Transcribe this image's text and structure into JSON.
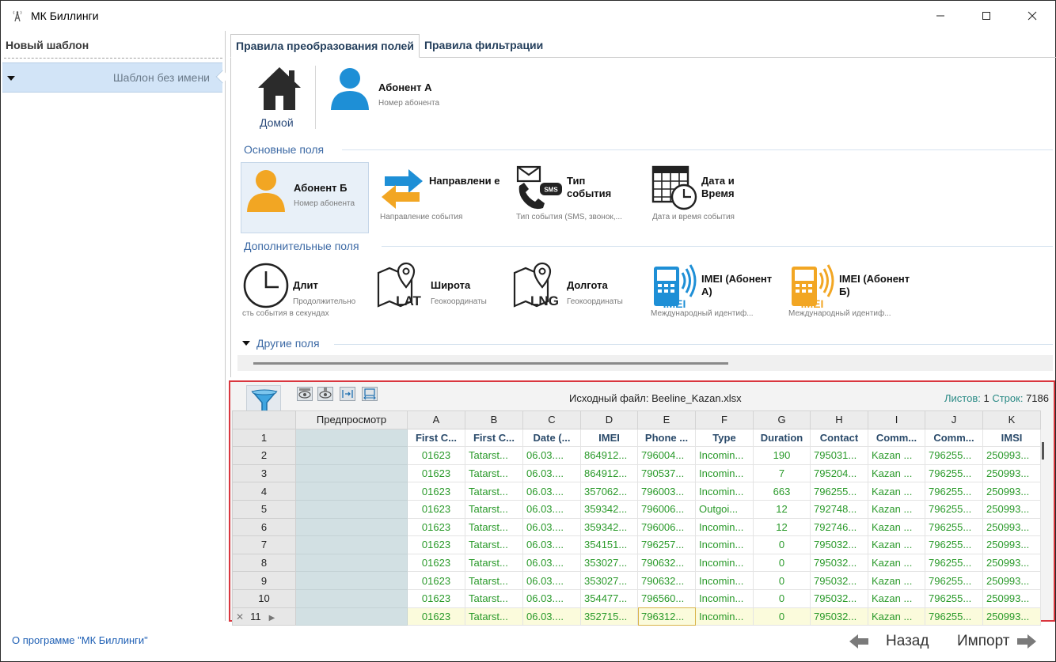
{
  "window": {
    "title": "МК Биллинги",
    "minimize": "—",
    "maximize": "☐",
    "close": "✕"
  },
  "left": {
    "title": "Новый шаблон",
    "item": "Шаблон без имени"
  },
  "tabs": [
    "Правила преобразования полей",
    "Правила фильтрации"
  ],
  "home": {
    "label": "Домой"
  },
  "abonent_a": {
    "title": "Абонент А",
    "subtitle": "Номер абонента"
  },
  "sections": {
    "main": "Основные поля",
    "extra": "Дополнительные поля",
    "other": "Другие поля"
  },
  "main_fields": [
    {
      "title": "Абонент Б",
      "subtitle": "Номер абонента"
    },
    {
      "title": "Направлени е",
      "subtitle": "Направление события"
    },
    {
      "title": "Тип события",
      "subtitle": "Тип события (SMS, звонок,..."
    },
    {
      "title": "Дата и Время",
      "subtitle": "Дата и время события"
    }
  ],
  "extra_fields": [
    {
      "title": "Длит",
      "subtitle": "Продолжительно",
      "subtitle2": "сть события в секундах"
    },
    {
      "title": "Широта",
      "subtitle": "Геокоординаты",
      "icon_text": "LAT"
    },
    {
      "title": "Долгота",
      "subtitle": "Геокоординаты",
      "icon_text": "LNG"
    },
    {
      "title": "IMEI (Абонент А)",
      "subtitle": "Международный идентиф...",
      "icon_text": "IMEI"
    },
    {
      "title": "IMEI (Абонент Б)",
      "subtitle": "Международный идентиф...",
      "icon_text": "IMEI"
    }
  ],
  "grid": {
    "source_file": "Исходный файл: Beeline_Kazan.xlsx",
    "sheets_label": "Листов:",
    "sheets_value": "1",
    "rows_label": "Строк:",
    "rows_value": "7186",
    "preview_header": "Предпросмотр",
    "columns": [
      "A",
      "B",
      "C",
      "D",
      "E",
      "F",
      "G",
      "H",
      "I",
      "J",
      "K"
    ],
    "headers": [
      "First C...",
      "First C...",
      "Date (...",
      "IMEI",
      "Phone ...",
      "Type",
      "Duration",
      "Contact",
      "Comm...",
      "Comm...",
      "IMSI"
    ],
    "rows": [
      [
        "2",
        "01623",
        "Tatarst...",
        "06.03....",
        "864912...",
        "796004...",
        "Incomin...",
        "190",
        "795031...",
        "Kazan ...",
        "796255...",
        "250993..."
      ],
      [
        "3",
        "01623",
        "Tatarst...",
        "06.03....",
        "864912...",
        "790537...",
        "Incomin...",
        "7",
        "795204...",
        "Kazan ...",
        "796255...",
        "250993..."
      ],
      [
        "4",
        "01623",
        "Tatarst...",
        "06.03....",
        "357062...",
        "796003...",
        "Incomin...",
        "663",
        "796255...",
        "Kazan ...",
        "796255...",
        "250993..."
      ],
      [
        "5",
        "01623",
        "Tatarst...",
        "06.03....",
        "359342...",
        "796006...",
        "Outgoi...",
        "12",
        "792748...",
        "Kazan ...",
        "796255...",
        "250993..."
      ],
      [
        "6",
        "01623",
        "Tatarst...",
        "06.03....",
        "359342...",
        "796006...",
        "Incomin...",
        "12",
        "792746...",
        "Kazan ...",
        "796255...",
        "250993..."
      ],
      [
        "7",
        "01623",
        "Tatarst...",
        "06.03....",
        "354151...",
        "796257...",
        "Incomin...",
        "0",
        "795032...",
        "Kazan ...",
        "796255...",
        "250993..."
      ],
      [
        "8",
        "01623",
        "Tatarst...",
        "06.03....",
        "353027...",
        "790632...",
        "Incomin...",
        "0",
        "795032...",
        "Kazan ...",
        "796255...",
        "250993..."
      ],
      [
        "9",
        "01623",
        "Tatarst...",
        "06.03....",
        "353027...",
        "790632...",
        "Incomin...",
        "0",
        "795032...",
        "Kazan ...",
        "796255...",
        "250993..."
      ],
      [
        "10",
        "01623",
        "Tatarst...",
        "06.03....",
        "354477...",
        "796560...",
        "Incomin...",
        "0",
        "795032...",
        "Kazan ...",
        "796255...",
        "250993..."
      ],
      [
        "11",
        "01623",
        "Tatarst...",
        "06.03....",
        "352715...",
        "796312...",
        "Incomin...",
        "0",
        "795032...",
        "Kazan ...",
        "796255...",
        "250993..."
      ]
    ]
  },
  "footer": {
    "about": "О программе \"МК Биллинги\"",
    "back": "Назад",
    "import": "Импорт"
  }
}
